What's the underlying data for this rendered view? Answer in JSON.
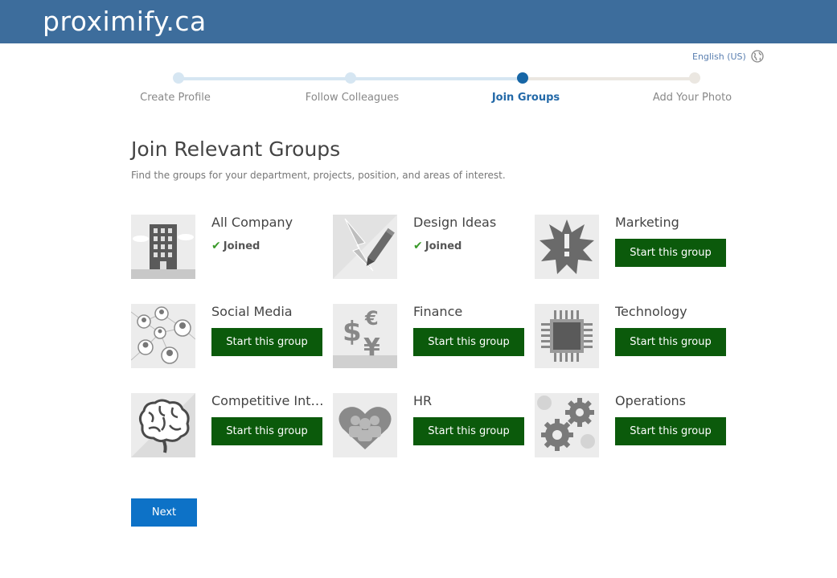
{
  "header": {
    "brand": "proximify.ca"
  },
  "language": {
    "label": "English (US)",
    "icon": "globe-icon"
  },
  "steps": [
    {
      "label": "Create Profile",
      "state": "done"
    },
    {
      "label": "Follow Colleagues",
      "state": "done"
    },
    {
      "label": "Join Groups",
      "state": "active"
    },
    {
      "label": "Add Your Photo",
      "state": "pending"
    }
  ],
  "page": {
    "title": "Join Relevant Groups",
    "subtitle": "Find the groups for your department, projects, position, and areas of interest."
  },
  "groups": [
    {
      "name": "All Company",
      "status": "joined",
      "status_label": "Joined",
      "icon": "building-icon"
    },
    {
      "name": "Design Ideas",
      "status": "joined",
      "status_label": "Joined",
      "icon": "lightning-pencil-icon"
    },
    {
      "name": "Marketing",
      "status": "start",
      "button_label": "Start this group",
      "icon": "starburst-alert-icon"
    },
    {
      "name": "Social Media",
      "status": "start",
      "button_label": "Start this group",
      "icon": "people-network-icon"
    },
    {
      "name": "Finance",
      "status": "start",
      "button_label": "Start this group",
      "icon": "currency-icon"
    },
    {
      "name": "Technology",
      "status": "start",
      "button_label": "Start this group",
      "icon": "chip-icon"
    },
    {
      "name": "Competitive Intelli...",
      "status": "start",
      "button_label": "Start this group",
      "icon": "brain-icon"
    },
    {
      "name": "HR",
      "status": "start",
      "button_label": "Start this group",
      "icon": "heart-people-icon"
    },
    {
      "name": "Operations",
      "status": "start",
      "button_label": "Start this group",
      "icon": "gears-icon"
    }
  ],
  "footer": {
    "next_label": "Next"
  },
  "colors": {
    "header": "#3d6d9c",
    "accent": "#2369a8",
    "start_button": "#0b5a0b",
    "next_button": "#0d72c7",
    "joined_check": "#3a9a2a"
  }
}
